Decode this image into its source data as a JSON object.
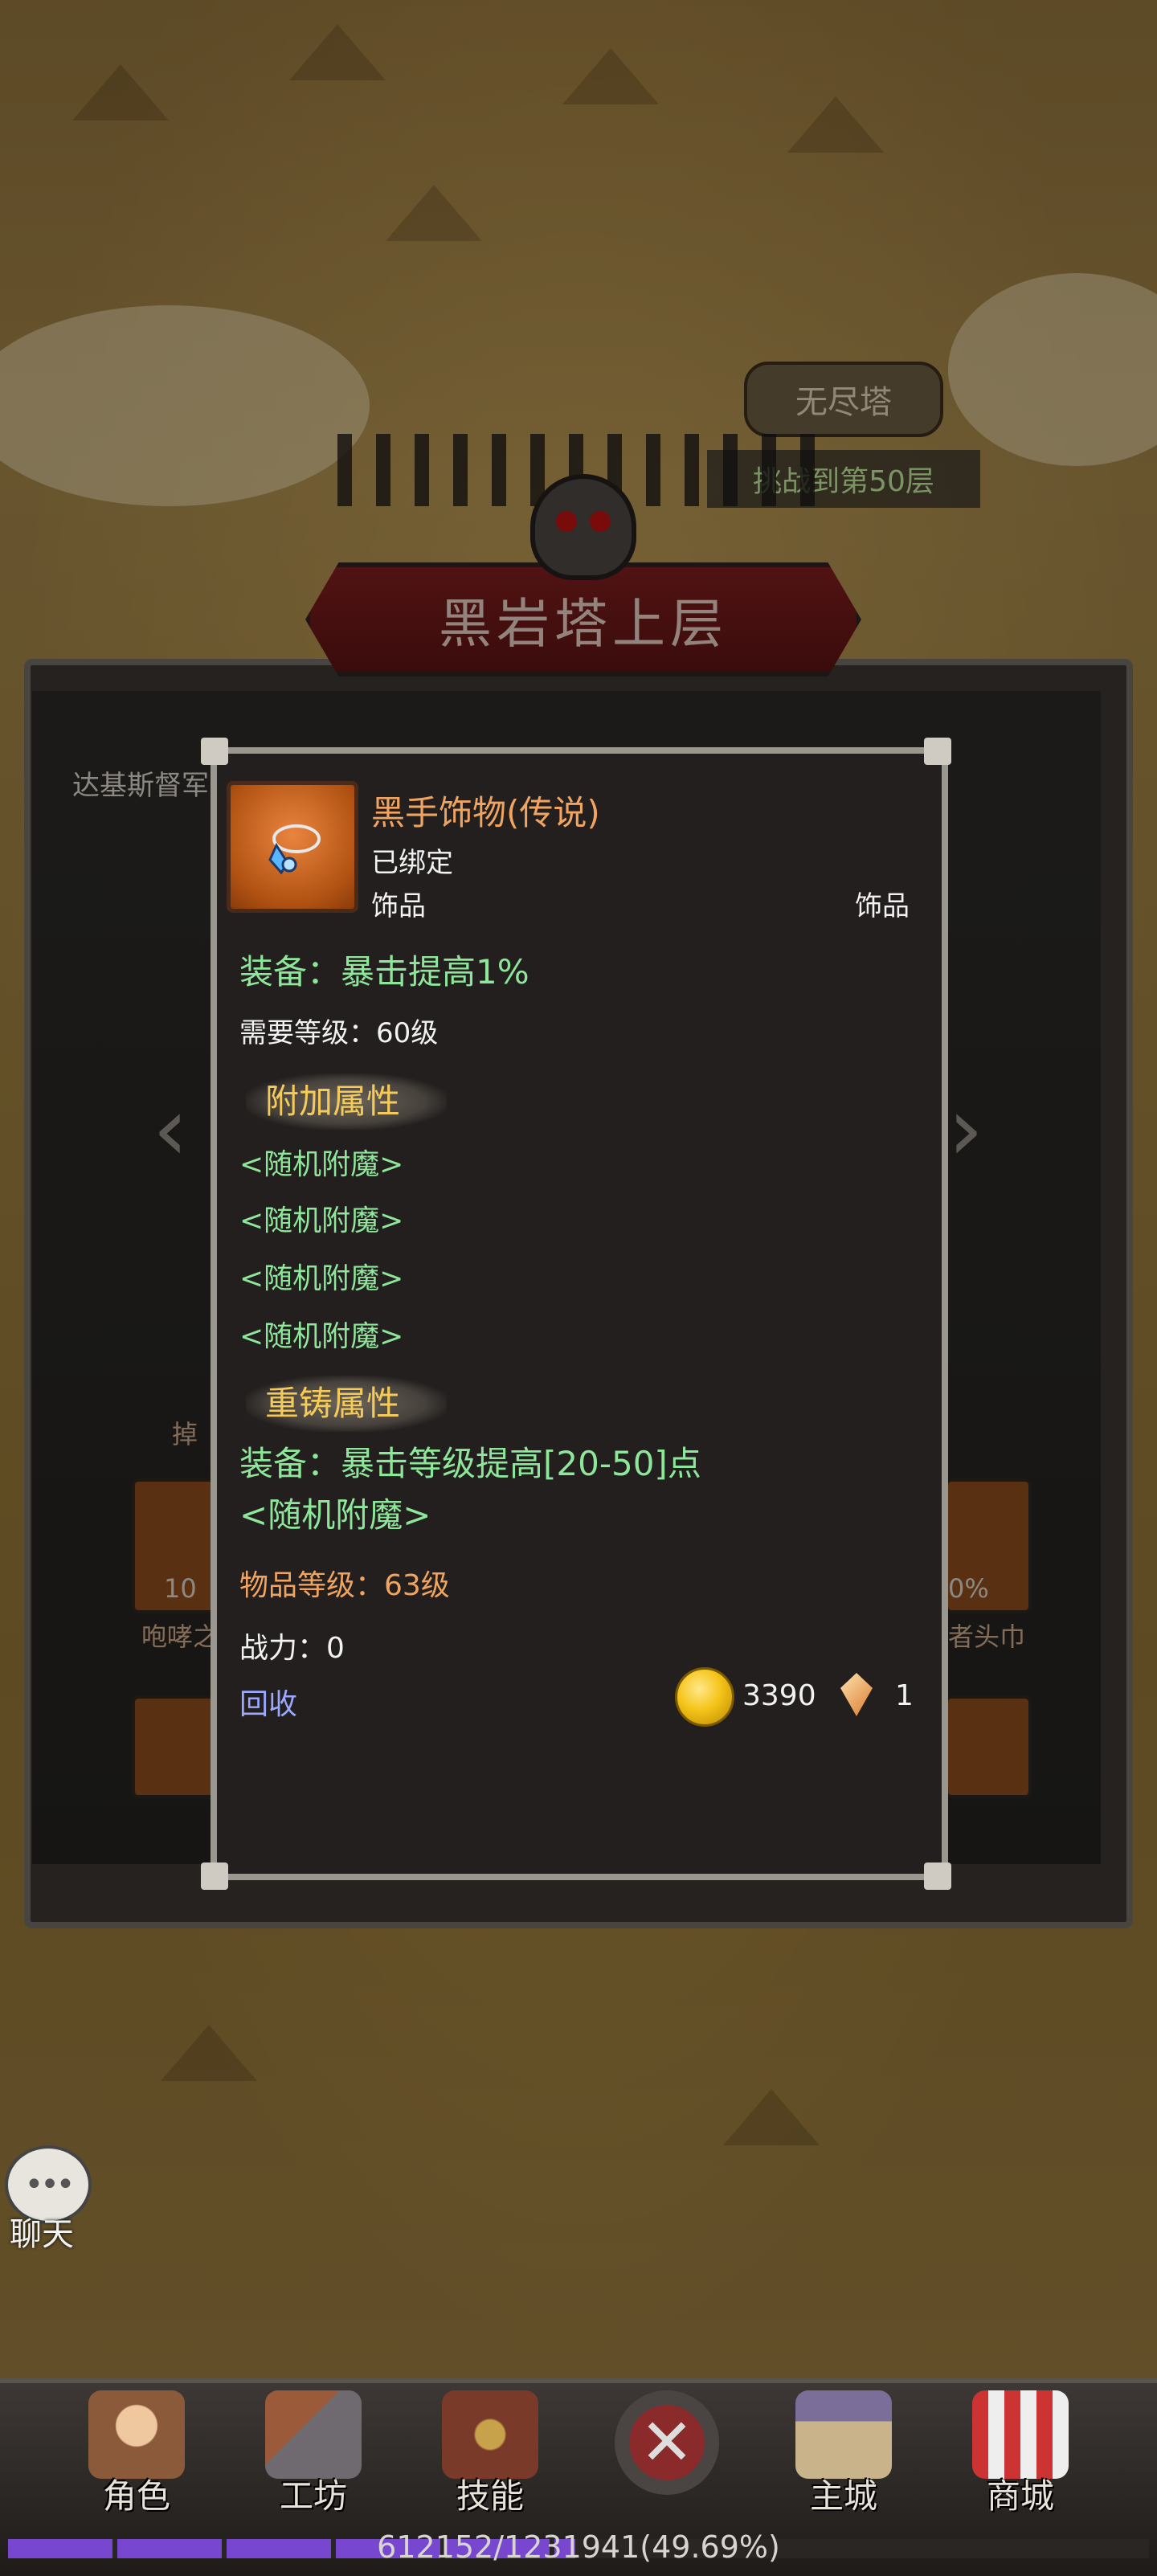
{
  "map": {
    "endless_tower": {
      "title": "无尽塔",
      "subtitle": "挑战到第50层"
    },
    "dungeon_banner": "黑岩塔上层",
    "location_label": "达基斯督军",
    "left_bottom_text": "咆哮之",
    "right_bottom_text": "者头巾",
    "right_percent": "0%",
    "left_percent": "10",
    "drop_label": "掉"
  },
  "item": {
    "name": "黑手饰物(传说)",
    "bind_status": "已绑定",
    "type_left": "饰品",
    "type_right": "饰品",
    "equip_effect": "装备：暴击提高1%",
    "required_level": "需要等级：60级",
    "extra_section_title": "附加属性",
    "extra_attributes": [
      "<随机附魔>",
      "<随机附魔>",
      "<随机附魔>",
      "<随机附魔>"
    ],
    "reforge_section_title": "重铸属性",
    "reforge_effect": "装备：暴击等级提高[20-50]点",
    "reforge_random": "<随机附魔>",
    "item_level": "物品等级：63级",
    "power": "战力：0",
    "recycle_label": "回收",
    "gold_amount": "3390",
    "gem_amount": "1"
  },
  "chat": {
    "label": "聊天",
    "bubble": "•••"
  },
  "bottom_nav": [
    {
      "label": "角色",
      "icon": "character-icon",
      "color": "#8a5a3a"
    },
    {
      "label": "工坊",
      "icon": "workshop-icon",
      "color": "#6f6a70"
    },
    {
      "label": "技能",
      "icon": "skills-icon",
      "color": "#7a3a2a"
    },
    {
      "label": "",
      "icon": "battle-icon",
      "color": "#6a2a2a"
    },
    {
      "label": "主城",
      "icon": "main-city-icon",
      "color": "#7b6f9a"
    },
    {
      "label": "商城",
      "icon": "shop-icon",
      "color": "#9a3b30"
    }
  ],
  "experience": {
    "text": "612152/1231941(49.69%)",
    "fraction": 0.4969
  }
}
